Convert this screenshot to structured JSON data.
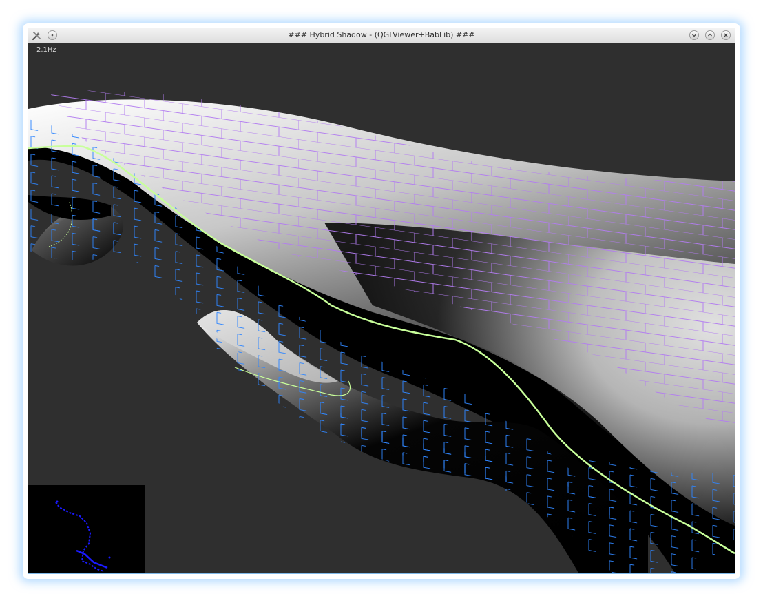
{
  "window": {
    "title": "### Hybrid Shadow - (QGLViewer+BabLib) ###",
    "buttons": [
      "minimize-icon",
      "maximize-icon",
      "close-icon"
    ]
  },
  "viewer": {
    "fps_label": "2.1Hz"
  },
  "colors": {
    "background": "#2f2f2f",
    "shadow_volume_lit": "#b27cf0",
    "shadow_volume_dark": "#2f86ff",
    "silhouette_line": "#c8ff9a",
    "minimap_points": "#1a1aff"
  }
}
